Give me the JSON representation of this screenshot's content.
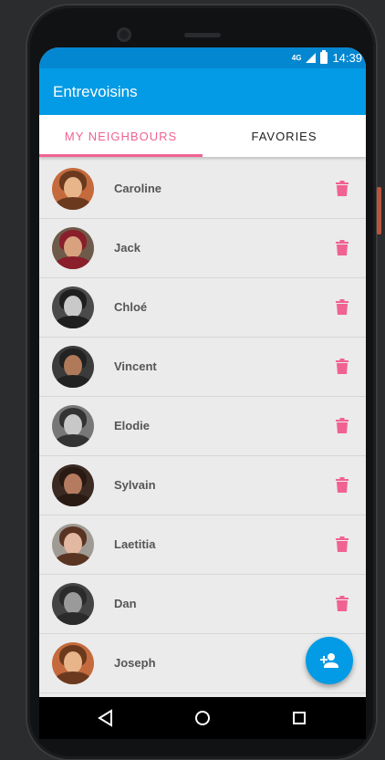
{
  "status_bar": {
    "time": "14:39",
    "network": "4G"
  },
  "app_bar": {
    "title": "Entrevoisins"
  },
  "tabs": [
    {
      "label": "MY NEIGHBOURS",
      "active": true
    },
    {
      "label": "FAVORIES",
      "active": false
    }
  ],
  "neighbours": [
    {
      "name": "Caroline"
    },
    {
      "name": "Jack"
    },
    {
      "name": "Chloé"
    },
    {
      "name": "Vincent"
    },
    {
      "name": "Elodie"
    },
    {
      "name": "Sylvain"
    },
    {
      "name": "Laetitia"
    },
    {
      "name": "Dan"
    },
    {
      "name": "Joseph"
    }
  ],
  "icons": {
    "delete": "trash-icon",
    "fab": "add-person-icon",
    "nav_back": "back-triangle-icon",
    "nav_home": "home-circle-icon",
    "nav_recents": "recents-square-icon"
  },
  "colors": {
    "primary": "#039be5",
    "primary_dark": "#0487d1",
    "accent": "#f06292",
    "list_background": "#ebebeb"
  }
}
